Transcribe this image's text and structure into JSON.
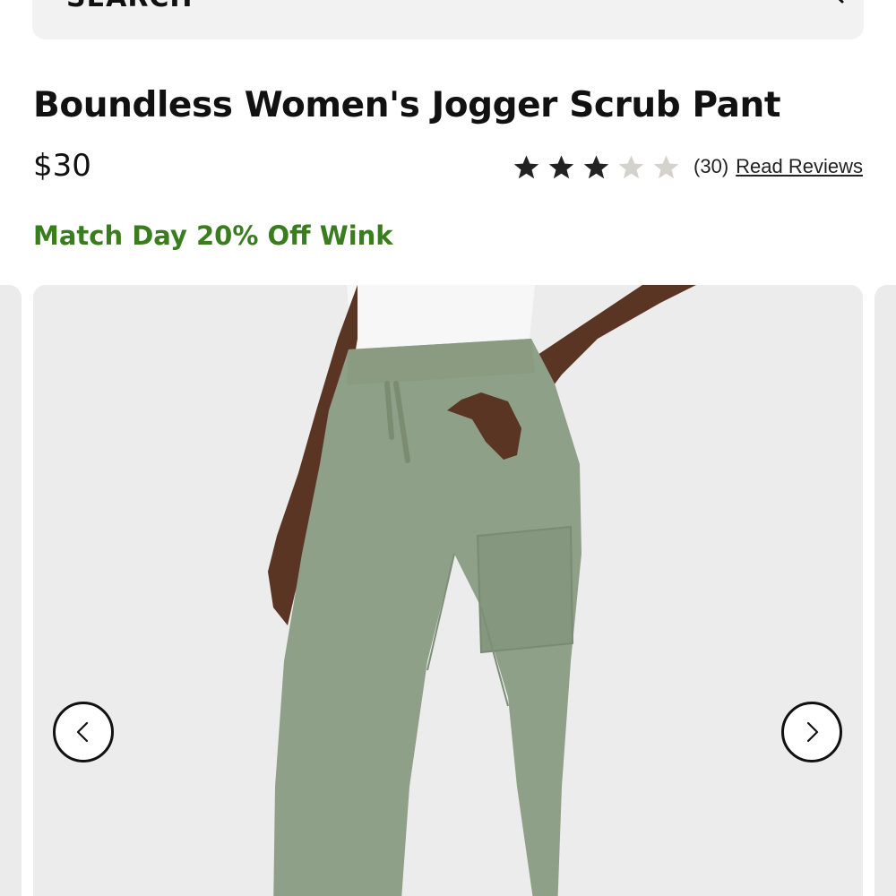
{
  "search": {
    "label": "SEARCH"
  },
  "product": {
    "title": "Boundless Women's Jogger Scrub Pant",
    "price": "$30",
    "rating": {
      "value": 3,
      "max": 5,
      "count_text": "(30)",
      "link_text": "Read Reviews"
    },
    "promo": "Match Day 20% Off Wink"
  },
  "gallery": {
    "prev_icon": "chevron-left-icon",
    "next_icon": "chevron-right-icon"
  },
  "colors": {
    "promo_green": "#3a7d1e",
    "star_filled": "#222222",
    "star_empty": "#d3d2cc",
    "pants": "#8fa088",
    "skin": "#5a3524"
  }
}
